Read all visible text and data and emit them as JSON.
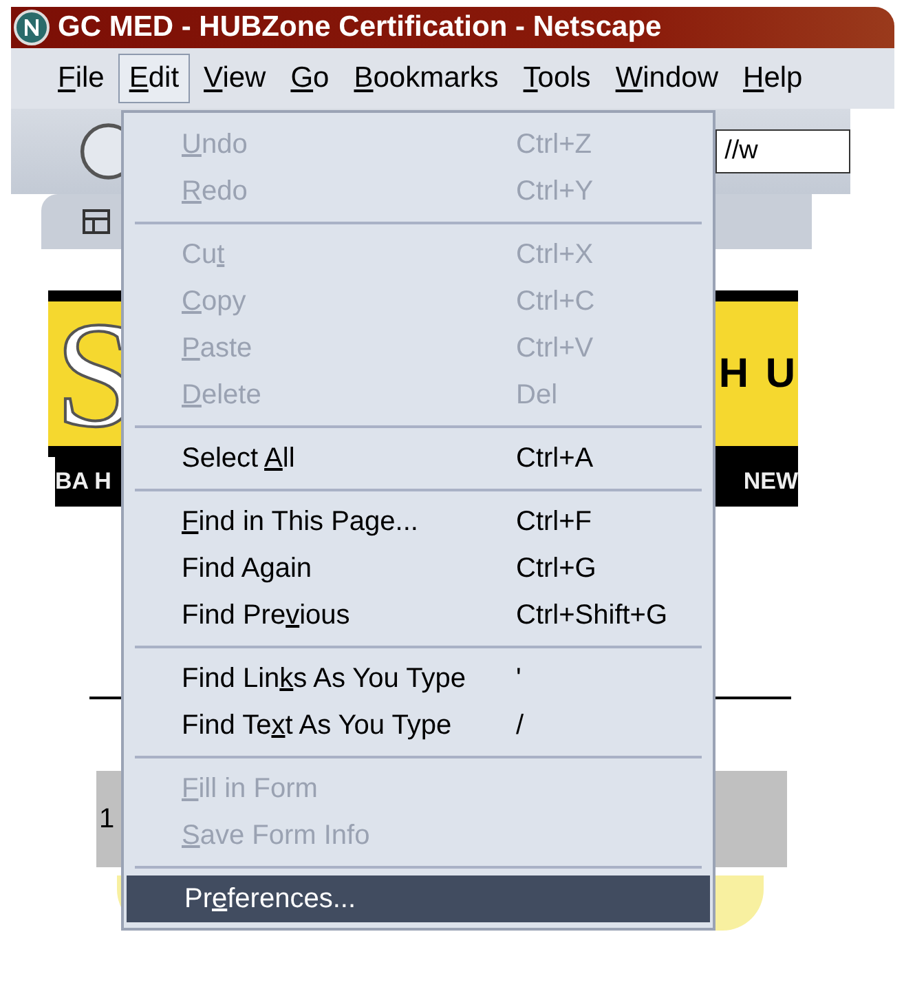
{
  "window": {
    "title": "GC MED - HUBZone Certification - Netscape"
  },
  "menu_bar": [
    {
      "key": "F",
      "post": "ile",
      "selected": false
    },
    {
      "key": "E",
      "post": "dit",
      "selected": true
    },
    {
      "key": "V",
      "post": "iew",
      "selected": false
    },
    {
      "key": "G",
      "post": "o",
      "selected": false
    },
    {
      "key": "B",
      "post": "ookmarks",
      "selected": false
    },
    {
      "key": "T",
      "post": "ools",
      "selected": false
    },
    {
      "key": "W",
      "post": "indow",
      "selected": false
    },
    {
      "key": "H",
      "post": "elp",
      "selected": false
    }
  ],
  "address_field": {
    "value": "//w"
  },
  "banner": {
    "logo_letter": "S",
    "heading_fragment": "H U",
    "strip_left": "BA H",
    "strip_right": "NEW"
  },
  "status_fragment": "1",
  "edit_menu": {
    "groups": [
      [
        {
          "key": "U",
          "post": "ndo",
          "shortcut": "Ctrl+Z",
          "disabled": true,
          "selected": false
        },
        {
          "key": "R",
          "post": "edo",
          "shortcut": "Ctrl+Y",
          "disabled": true,
          "selected": false
        }
      ],
      [
        {
          "pre": "Cu",
          "key": "t",
          "shortcut": "Ctrl+X",
          "disabled": true,
          "selected": false
        },
        {
          "key": "C",
          "post": "opy",
          "shortcut": "Ctrl+C",
          "disabled": true,
          "selected": false
        },
        {
          "key": "P",
          "post": "aste",
          "shortcut": "Ctrl+V",
          "disabled": true,
          "selected": false
        },
        {
          "key": "D",
          "post": "elete",
          "shortcut": "Del",
          "disabled": true,
          "selected": false
        }
      ],
      [
        {
          "pre": "Select ",
          "key": "A",
          "post": "ll",
          "shortcut": "Ctrl+A",
          "disabled": false,
          "selected": false
        }
      ],
      [
        {
          "key": "F",
          "post": "ind in This Page...",
          "shortcut": "Ctrl+F",
          "disabled": false,
          "selected": false
        },
        {
          "pre": "Find Again",
          "shortcut": "Ctrl+G",
          "disabled": false,
          "selected": false
        },
        {
          "pre": "Find Pre",
          "key": "v",
          "post": "ious",
          "shortcut": "Ctrl+Shift+G",
          "disabled": false,
          "selected": false
        }
      ],
      [
        {
          "pre": "Find Lin",
          "key": "k",
          "post": "s As You Type",
          "shortcut": "'",
          "disabled": false,
          "selected": false
        },
        {
          "pre": "Find Te",
          "key": "x",
          "post": "t As You Type",
          "shortcut": "/",
          "disabled": false,
          "selected": false
        }
      ],
      [
        {
          "key": "F",
          "post": "ill in Form",
          "disabled": true,
          "selected": false
        },
        {
          "key": "S",
          "post": "ave Form Info",
          "disabled": true,
          "selected": false
        }
      ],
      [
        {
          "pre": "Pr",
          "key": "e",
          "post": "ferences...",
          "disabled": false,
          "selected": true
        }
      ]
    ]
  }
}
